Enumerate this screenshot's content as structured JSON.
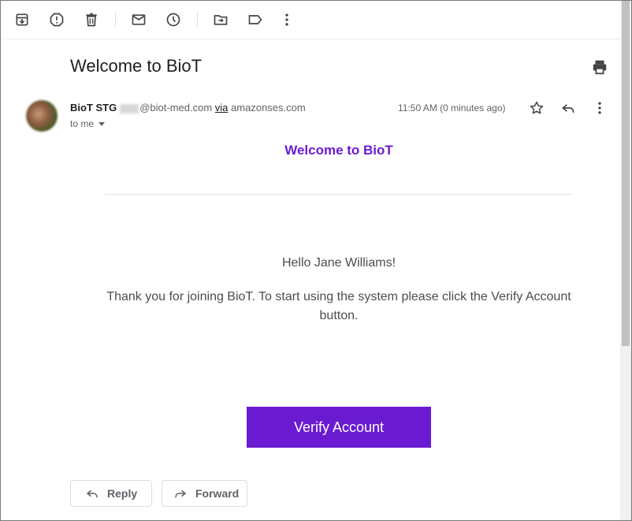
{
  "toolbar": {
    "icons": [
      "archive-icon",
      "report-spam-icon",
      "delete-icon",
      "mark-unread-icon",
      "snooze-icon",
      "move-to-icon",
      "label-icon",
      "more-vert-icon"
    ]
  },
  "email": {
    "subject": "Welcome to BioT",
    "sender_name": "BioT STG",
    "sender_domain": "@biot-med.com",
    "via_label": "via",
    "via_domain": "amazonses.com",
    "to": "to me",
    "time": "11:50 AM (0 minutes ago)"
  },
  "content": {
    "heading": "Welcome to BioT",
    "greeting": "Hello Jane Williams!",
    "message": "Thank you for joining BioT. To start using the system please click the Verify Account button.",
    "button_label": "Verify Account",
    "accent_color": "#6a1bd1"
  },
  "actions": {
    "reply_label": "Reply",
    "forward_label": "Forward"
  }
}
